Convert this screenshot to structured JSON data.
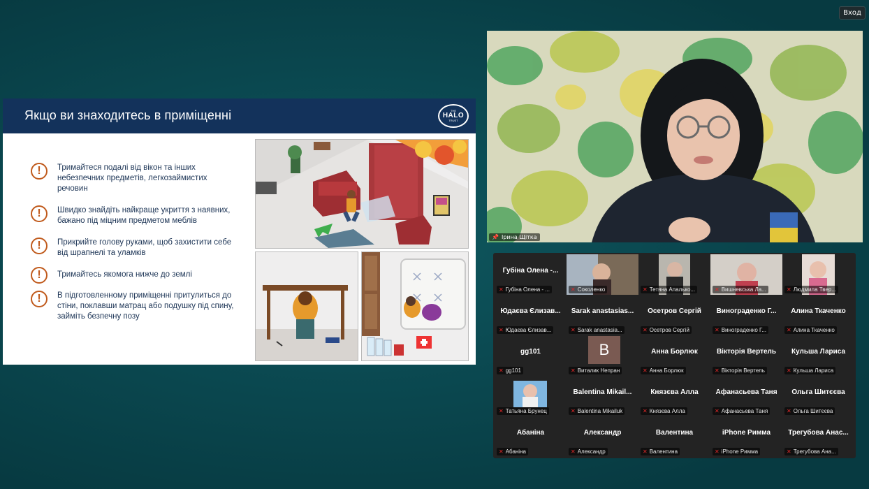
{
  "header": {
    "enter_label": "Вход"
  },
  "slide": {
    "title": "Якщо ви знаходитесь в приміщенні",
    "logo": {
      "line1": "THE",
      "line2": "HALO",
      "line3": "TRUST"
    },
    "tips": [
      "Тримайтеся подалі від вікон та інших небезпечних предметів, легкозаймистих речовин",
      "Швидко знайдіть найкраще укриття з наявних, бажано під міцним предметом меблів",
      "Прикрийте голову руками, щоб захистити себе від шрапнелі та уламків",
      "Тримайтесь якомога нижче до землі",
      "В підготовленному приміщенні притулиться до стіни, поклавши матрац  або подушку під спину, займіть безпечну позу"
    ],
    "icon_glyph": "!"
  },
  "presenter": {
    "name": "Ірина Щітка"
  },
  "gallery": {
    "tiles": [
      {
        "big": "Губіна Олена -...",
        "label": "Губіна Олена - ...",
        "video": false
      },
      {
        "big": "",
        "label": "Соколенко",
        "video": true
      },
      {
        "big": "",
        "label": "Тетяна Апалько...",
        "video": true
      },
      {
        "big": "",
        "label": "Вишневська Ла...",
        "video": true
      },
      {
        "big": "",
        "label": "Людмила Твер...",
        "video": true
      },
      {
        "big": "Юдаєва Єлизав...",
        "label": "Юдаєва Єлизав...",
        "video": false
      },
      {
        "big": "Sarak anastasias...",
        "label": "Sarak anastasia...",
        "video": false
      },
      {
        "big": "Осетров Сергій",
        "label": "Осетров Сергій",
        "video": false
      },
      {
        "big": "Винограденко Г...",
        "label": "Винограденко Г...",
        "video": false
      },
      {
        "big": "Алина Ткаченко",
        "label": "Алина Ткаченко",
        "video": false
      },
      {
        "big": "gg101",
        "label": "gg101",
        "video": false
      },
      {
        "big": "",
        "label": "Виталик Непран",
        "video": false,
        "avatar": "B"
      },
      {
        "big": "Анна Борлюк",
        "label": "Анна Борлюк",
        "video": false
      },
      {
        "big": "Вікторія Вертель",
        "label": "Вікторія Вертель",
        "video": false
      },
      {
        "big": "Кульша Лариса",
        "label": "Кульша Лариса",
        "video": false
      },
      {
        "big": "",
        "label": "Татьяна Брунец",
        "video": true
      },
      {
        "big": "Balentina Mikail...",
        "label": "Balentina Mikailuk",
        "video": false
      },
      {
        "big": "Князєва Алла",
        "label": "Князєва Алла",
        "video": false
      },
      {
        "big": "Афанасьева Таня",
        "label": "Афанасьева Таня",
        "video": false
      },
      {
        "big": "Ольга Шитєєва",
        "label": "Ольга Шитєєва",
        "video": false
      },
      {
        "big": "Абаніна",
        "label": "Абаніна",
        "video": false
      },
      {
        "big": "Александр",
        "label": "Александр",
        "video": false
      },
      {
        "big": "Валентина",
        "label": "Валентина",
        "video": false
      },
      {
        "big": "iPhone Римма",
        "label": "iPhone Римма",
        "video": false
      },
      {
        "big": "Трегубова Анас...",
        "label": "Трегубова Ана...",
        "video": false
      }
    ]
  },
  "colors": {
    "slide_header": "#13325b",
    "tip_accent": "#c05a1c",
    "muted_mic": "#e02828"
  },
  "icons": {
    "muted": "mic-off-icon",
    "pin": "pin-icon"
  }
}
